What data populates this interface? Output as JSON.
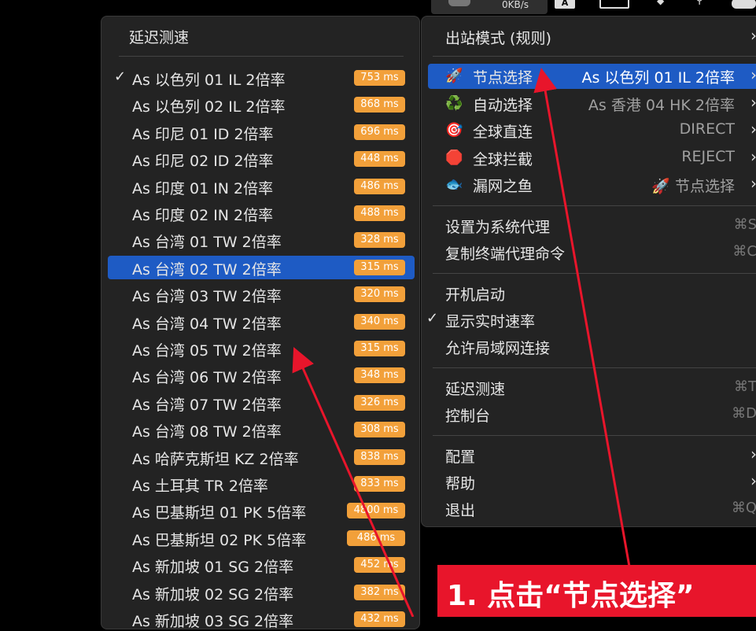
{
  "menubar": {
    "speed": "0KB/s",
    "input_icon": "A"
  },
  "left_menu": {
    "title": "延迟测速",
    "items": [
      {
        "label": "As 以色列 01 IL 2倍率",
        "latency": "753 ms",
        "checked": true
      },
      {
        "label": "As 以色列 02 IL 2倍率",
        "latency": "868 ms"
      },
      {
        "label": "As 印尼 01 ID 2倍率",
        "latency": "696 ms"
      },
      {
        "label": "As 印尼 02 ID 2倍率",
        "latency": "448 ms"
      },
      {
        "label": "As 印度 01 IN 2倍率",
        "latency": "486 ms"
      },
      {
        "label": "As 印度 02 IN 2倍率",
        "latency": "488 ms"
      },
      {
        "label": "As 台湾 01 TW 2倍率",
        "latency": "328 ms"
      },
      {
        "label": "As 台湾 02 TW 2倍率",
        "latency": "315 ms",
        "selected": true
      },
      {
        "label": "As 台湾 03 TW 2倍率",
        "latency": "320 ms"
      },
      {
        "label": "As 台湾 04 TW 2倍率",
        "latency": "340 ms"
      },
      {
        "label": "As 台湾 05 TW 2倍率",
        "latency": "315 ms"
      },
      {
        "label": "As 台湾 06 TW 2倍率",
        "latency": "348 ms"
      },
      {
        "label": "As 台湾 07 TW 2倍率",
        "latency": "326 ms"
      },
      {
        "label": "As 台湾 08 TW 2倍率",
        "latency": "308 ms"
      },
      {
        "label": "As 哈萨克斯坦 KZ 2倍率",
        "latency": "838 ms"
      },
      {
        "label": "As 土耳其 TR 2倍率",
        "latency": "833 ms"
      },
      {
        "label": "As 巴基斯坦 01 PK 5倍率",
        "latency": "4800 ms"
      },
      {
        "label": "As 巴基斯坦 02 PK 5倍率",
        "latency": "486 ms"
      },
      {
        "label": "As 新加坡 01 SG 2倍率",
        "latency": "452 ms"
      },
      {
        "label": "As 新加坡 02 SG 2倍率",
        "latency": "382 ms"
      },
      {
        "label": "As 新加坡 03 SG 2倍率",
        "latency": "432 ms"
      }
    ]
  },
  "right_menu": {
    "outbound_mode": "出站模式 (规则)",
    "groups": [
      {
        "icon": "🚀",
        "label": "节点选择",
        "value": "As 以色列 01 IL 2倍率",
        "selected": true
      },
      {
        "icon": "♻️",
        "label": "自动选择",
        "value": "As 香港 04 HK 2倍率"
      },
      {
        "icon": "🎯",
        "label": "全球直连",
        "value": "DIRECT"
      },
      {
        "icon": "🛑",
        "label": "全球拦截",
        "value": "REJECT"
      },
      {
        "icon": "🐟",
        "label": "漏网之鱼",
        "value": "🚀 节点选择"
      }
    ],
    "set_system_proxy": {
      "label": "设置为系统代理",
      "shortcut": "⌘S"
    },
    "copy_terminal": {
      "label": "复制终端代理命令",
      "shortcut": "⌘C"
    },
    "launch_at_login": "开机启动",
    "show_speed": "显示实时速率",
    "allow_lan": "允许局域网连接",
    "speed_test": {
      "label": "延迟测速",
      "shortcut": "⌘T"
    },
    "console": {
      "label": "控制台",
      "shortcut": "⌘D"
    },
    "config": "配置",
    "help": "帮助",
    "quit": {
      "label": "退出",
      "shortcut": "⌘Q"
    }
  },
  "annotation": {
    "callout": "1. 点击“节点选择”",
    "color": "#e8152b"
  },
  "colors": {
    "accent": "#1e5bc4",
    "badge": "#f2a03a",
    "menu_bg": "#232323"
  }
}
